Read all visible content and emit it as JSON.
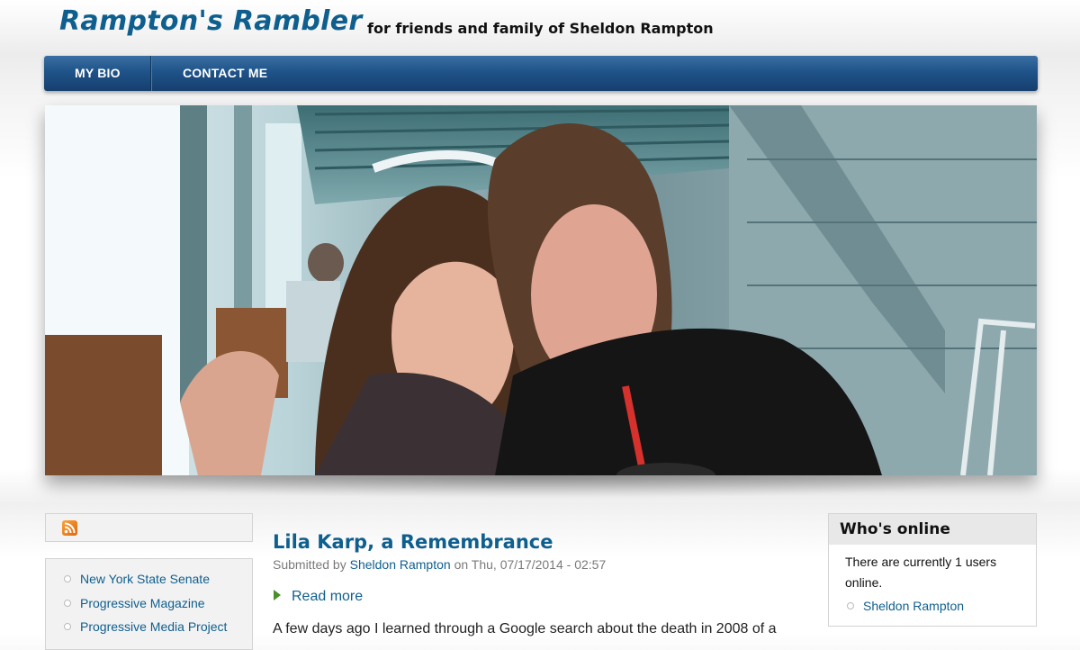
{
  "site": {
    "name": "Rampton's Rambler",
    "slogan": "for friends and family of Sheldon Rampton"
  },
  "nav": {
    "items": [
      {
        "label": "MY BIO"
      },
      {
        "label": "CONTACT ME"
      }
    ]
  },
  "sidebar": {
    "rss_icon": "rss-feed-icon",
    "links": [
      {
        "label": "New York State Senate"
      },
      {
        "label": "Progressive Magazine"
      },
      {
        "label": "Progressive Media Project"
      }
    ]
  },
  "article": {
    "title": "Lila Karp, a Remembrance",
    "submitted_prefix": "Submitted by",
    "author": "Sheldon Rampton",
    "date_text": "on Thu, 07/17/2014 - 02:57",
    "read_more": "Read more",
    "body_start": "A few days ago I learned through a Google search about the death in 2008 of a"
  },
  "online": {
    "title": "Who's online",
    "text": "There are currently 1 users online.",
    "users": [
      "Sheldon Rampton"
    ]
  },
  "colors": {
    "link": "#0f5f8e",
    "nav_bg": "#1f5389",
    "arrow": "#4a8f2a"
  }
}
